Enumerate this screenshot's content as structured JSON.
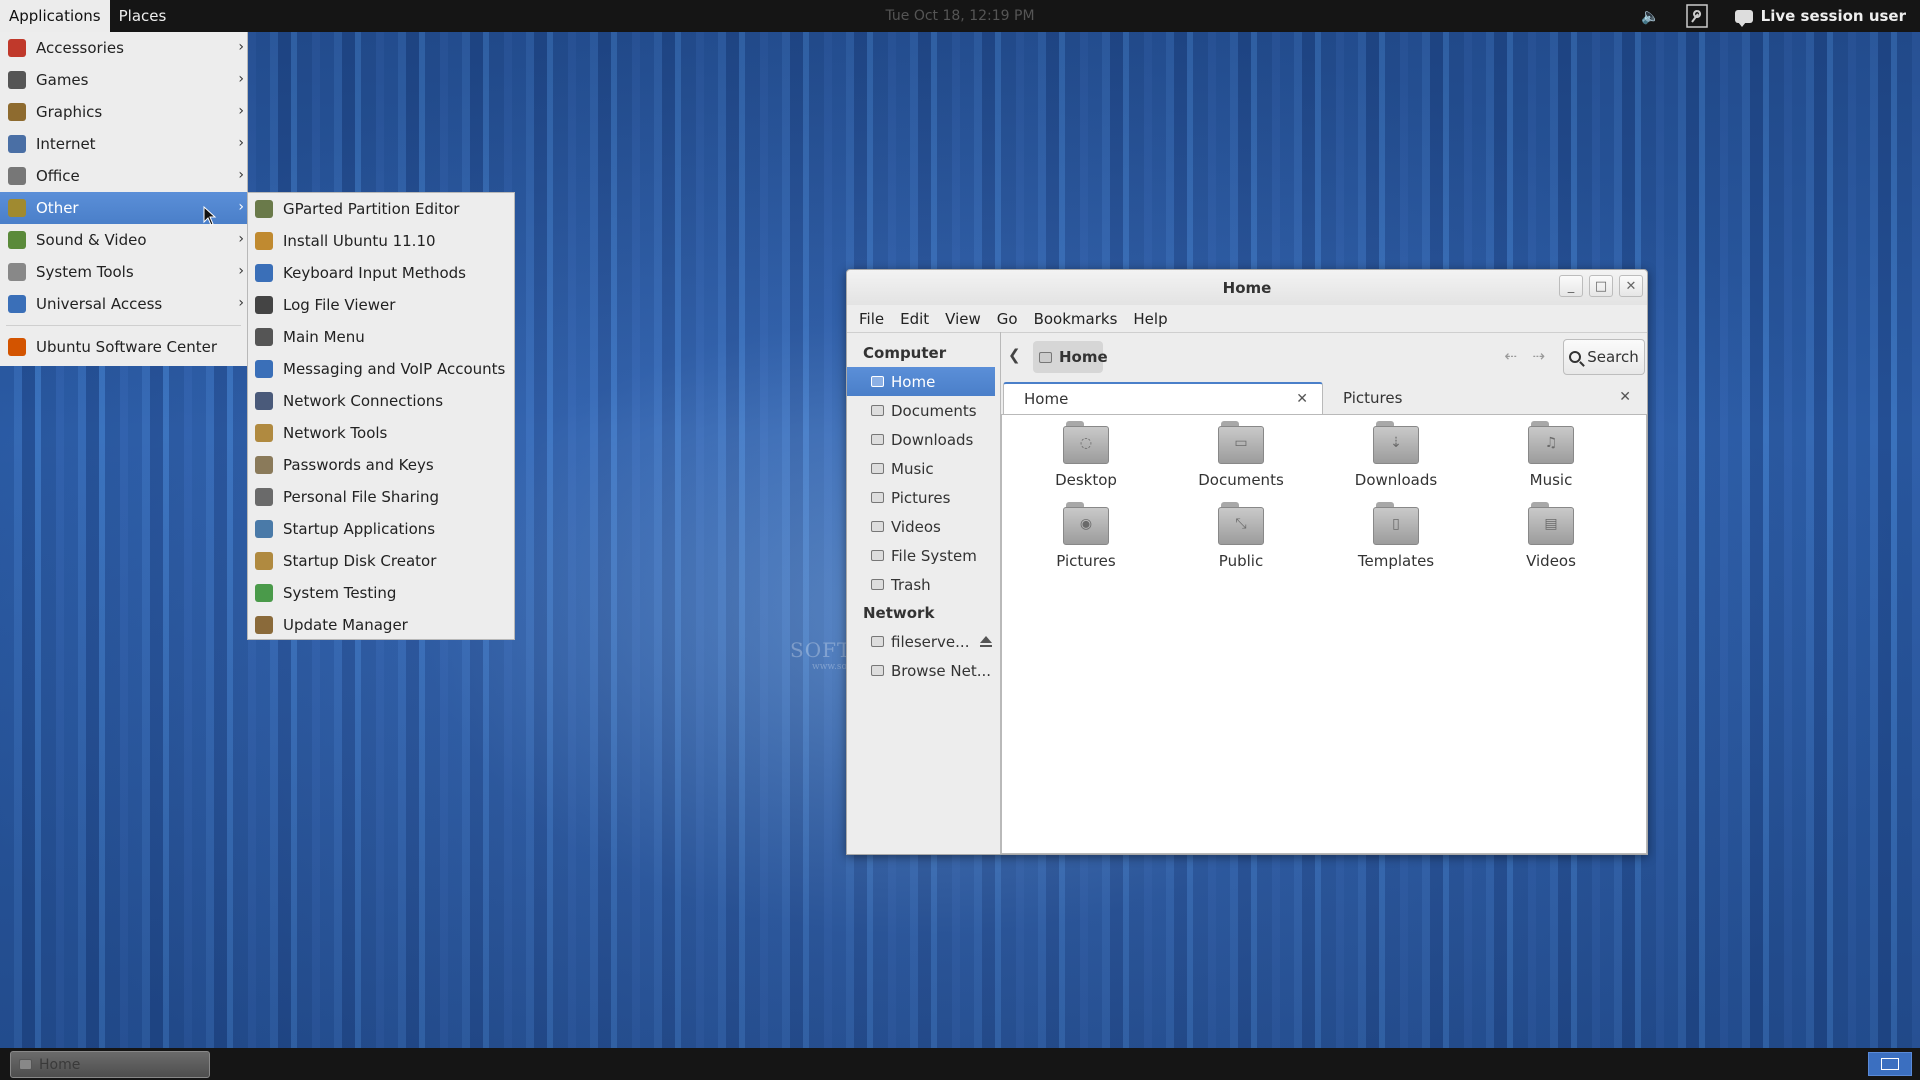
{
  "topbar": {
    "applications": "Applications",
    "places": "Places",
    "clock": "Tue Oct 18, 12:19 PM",
    "volume_icon": "volume-icon",
    "user": "Live session user"
  },
  "app_menu": {
    "items": [
      {
        "label": "Accessories",
        "icon": "accessories-icon",
        "color": "#c0392b"
      },
      {
        "label": "Games",
        "icon": "games-icon",
        "color": "#555555"
      },
      {
        "label": "Graphics",
        "icon": "graphics-icon",
        "color": "#8e6b2f"
      },
      {
        "label": "Internet",
        "icon": "internet-icon",
        "color": "#4a6fa5"
      },
      {
        "label": "Office",
        "icon": "office-icon",
        "color": "#777777"
      },
      {
        "label": "Other",
        "icon": "other-icon",
        "color": "#a08a30"
      },
      {
        "label": "Sound & Video",
        "icon": "sound-video-icon",
        "color": "#5a8a3a"
      },
      {
        "label": "System Tools",
        "icon": "system-tools-icon",
        "color": "#888888"
      },
      {
        "label": "Universal Access",
        "icon": "universal-access-icon",
        "color": "#3a6fb8"
      }
    ],
    "software_center": "Ubuntu Software Center"
  },
  "submenu": {
    "items": [
      "GParted Partition Editor",
      "Install Ubuntu 11.10",
      "Keyboard Input Methods",
      "Log File Viewer",
      "Main Menu",
      "Messaging and VoIP Accounts",
      "Network Connections",
      "Network Tools",
      "Passwords and Keys",
      "Personal File Sharing",
      "Startup Applications",
      "Startup Disk Creator",
      "System Testing",
      "Update Manager"
    ]
  },
  "window": {
    "title": "Home",
    "menus": [
      "File",
      "Edit",
      "View",
      "Go",
      "Bookmarks",
      "Help"
    ],
    "sidebar": {
      "computer_heading": "Computer",
      "computer_items": [
        "Home",
        "Documents",
        "Downloads",
        "Music",
        "Pictures",
        "Videos",
        "File System",
        "Trash"
      ],
      "network_heading": "Network",
      "network_items": [
        "fileserve...",
        "Browse Net..."
      ]
    },
    "path": "Home",
    "search": "Search",
    "tabs": [
      "Home",
      "Pictures"
    ],
    "folders": [
      "Desktop",
      "Documents",
      "Downloads",
      "Music",
      "Pictures",
      "Public",
      "Templates",
      "Videos"
    ]
  },
  "watermark": {
    "main": "SOFTPEDIA",
    "sub": "www.softpedia.com"
  },
  "taskbar": {
    "task": "Home"
  }
}
